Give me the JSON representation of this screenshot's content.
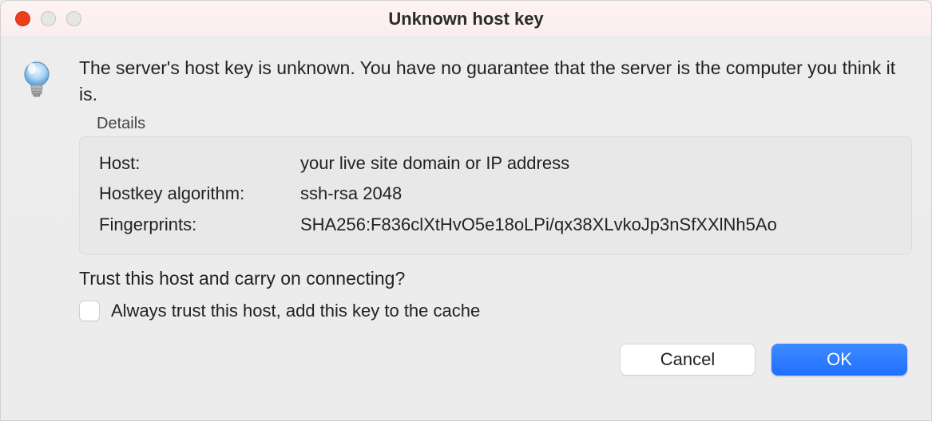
{
  "title": "Unknown host key",
  "message": "The server's host key is unknown. You have no guarantee that the server is the computer you think it is.",
  "details": {
    "label": "Details",
    "rows": [
      {
        "key": "Host:",
        "value": "your live site domain or IP address"
      },
      {
        "key": "Hostkey algorithm:",
        "value": "ssh-rsa 2048"
      },
      {
        "key": "Fingerprints:",
        "value": "SHA256:F836clXtHvO5e18oLPi/qx38XLvkoJp3nSfXXlNh5Ao"
      }
    ]
  },
  "question": "Trust this host and carry on connecting?",
  "checkbox_label": "Always trust this host, add this key to the cache",
  "buttons": {
    "cancel": "Cancel",
    "ok": "OK"
  }
}
